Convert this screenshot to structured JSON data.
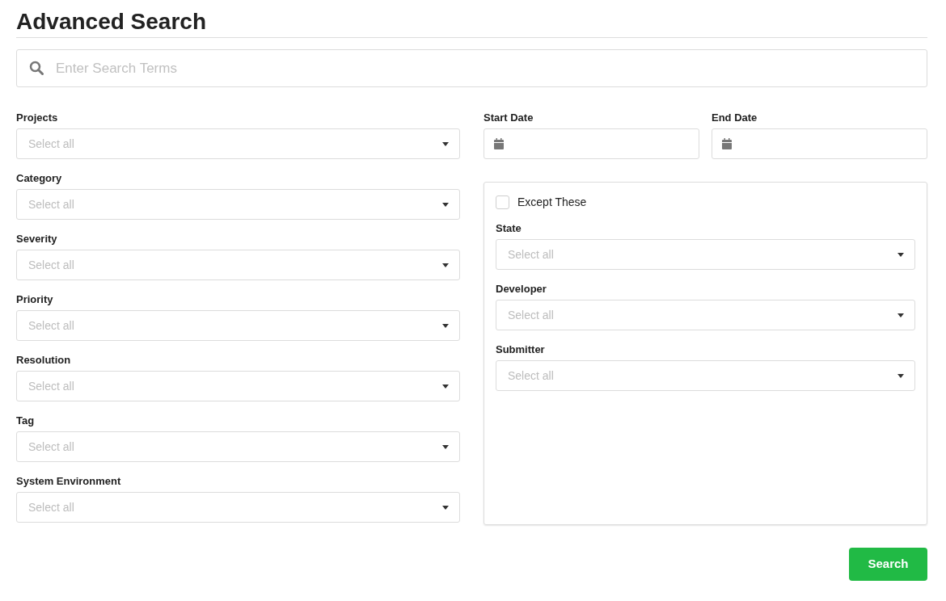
{
  "title": "Advanced Search",
  "search": {
    "placeholder": "Enter Search Terms"
  },
  "filters": [
    {
      "label": "Projects",
      "placeholder": "Select all"
    },
    {
      "label": "Category",
      "placeholder": "Select all"
    },
    {
      "label": "Severity",
      "placeholder": "Select all"
    },
    {
      "label": "Priority",
      "placeholder": "Select all"
    },
    {
      "label": "Resolution",
      "placeholder": "Select all"
    },
    {
      "label": "Tag",
      "placeholder": "Select all"
    },
    {
      "label": "System Environment",
      "placeholder": "Select all"
    }
  ],
  "dates": [
    {
      "label": "Start Date"
    },
    {
      "label": "End Date"
    }
  ],
  "exclusions": {
    "except": {
      "label": "Except These",
      "checked": false
    },
    "filters": [
      {
        "label": "State",
        "placeholder": "Select all"
      },
      {
        "label": "Developer",
        "placeholder": "Select all"
      },
      {
        "label": "Submitter",
        "placeholder": "Select all"
      }
    ]
  },
  "submit": "Search"
}
